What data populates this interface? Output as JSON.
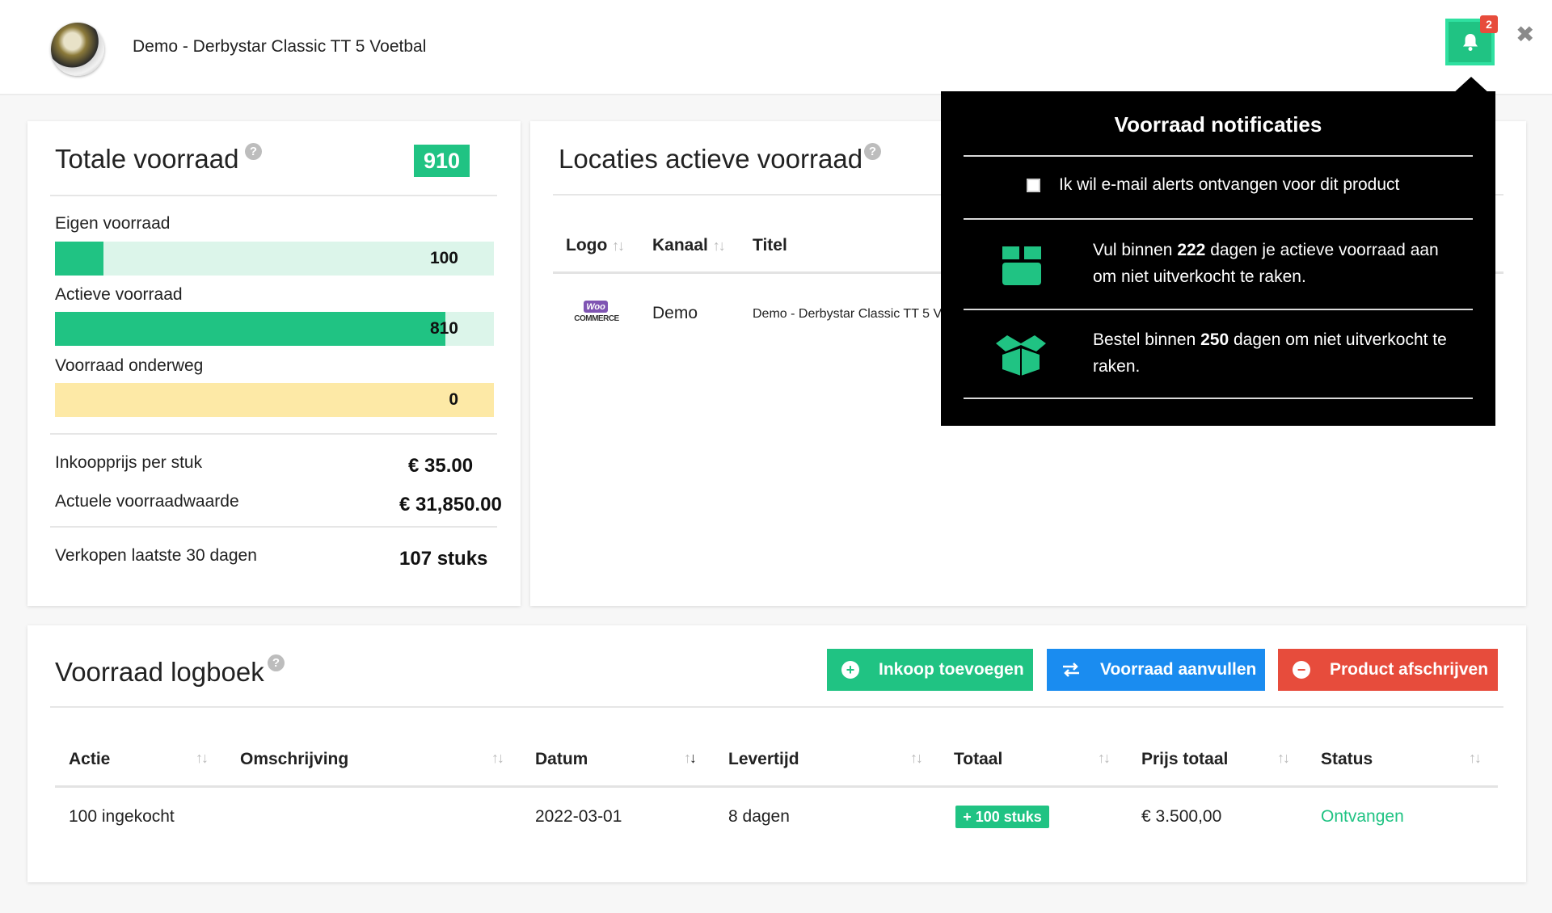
{
  "header": {
    "title": "Demo - Derbystar Classic TT 5 Voetbal",
    "notification_count": "2",
    "close_glyph": "✖"
  },
  "total": {
    "title": "Totale voorraad",
    "badge": "910",
    "bars": [
      {
        "label": "Eigen voorraad",
        "value": "100",
        "fill_fraction": 0.11
      },
      {
        "label": "Actieve voorraad",
        "value": "810",
        "fill_fraction": 0.89
      },
      {
        "label": "Voorraad onderweg",
        "value": "0",
        "fill_fraction": 0.0
      }
    ],
    "purchase_price_label": "Inkoopprijs per stuk",
    "purchase_price_value": "€ 35.00",
    "stock_value_label": "Actuele voorraadwaarde",
    "stock_value_value": "€ 31,850.00",
    "sales_label": "Verkopen laatste 30 dagen",
    "sales_value": "107 stuks"
  },
  "locations": {
    "title": "Locaties actieve voorraad",
    "columns": [
      "Logo",
      "Kanaal",
      "Titel"
    ],
    "rows": [
      {
        "logo_top": "Woo",
        "logo_bottom": "COMMERCE",
        "kanaal": "Demo",
        "titel": "Demo - Derbystar Classic TT 5 V"
      }
    ]
  },
  "logbook": {
    "title": "Voorraad logboek",
    "buttons": {
      "add_purchase": "Inkoop toevoegen",
      "replenish": "Voorraad aanvullen",
      "write_off": "Product afschrijven"
    },
    "columns": [
      "Actie",
      "Omschrijving",
      "Datum",
      "Levertijd",
      "Totaal",
      "Prijs totaal",
      "Status"
    ],
    "rows": [
      {
        "actie": "100 ingekocht",
        "omschrijving": "",
        "datum": "2022-03-01",
        "levertijd": "8 dagen",
        "totaal": "+ 100 stuks",
        "prijs": "€ 3.500,00",
        "status": "Ontvangen"
      }
    ]
  },
  "notifications": {
    "title": "Voorraad notificaties",
    "email_alert_label": "Ik wil e-mail alerts ontvangen voor dit product",
    "item1_pre": "Vul binnen ",
    "item1_bold": "222",
    "item1_post": " dagen je actieve voorraad aan om niet uitverkocht te raken.",
    "item2_pre": "Bestel binnen ",
    "item2_bold": "250",
    "item2_post": " dagen om niet uitverkocht te raken."
  },
  "colors": {
    "accent_green": "#20c383",
    "light_green": "#dcf5ea",
    "yellow": "#fde9a6",
    "blue": "#1a8cf0",
    "red": "#e74c3c"
  }
}
